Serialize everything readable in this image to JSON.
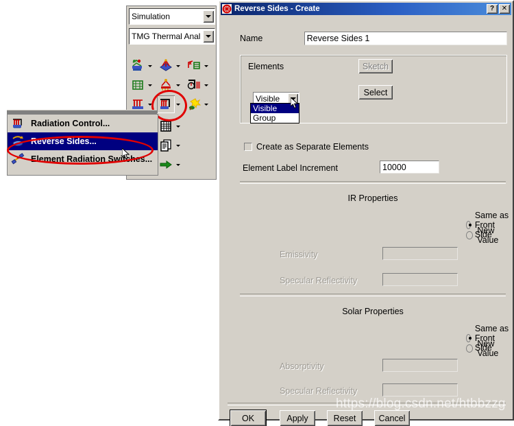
{
  "app": {
    "combos": [
      {
        "name": "application-selector",
        "value": "Simulation"
      },
      {
        "name": "solver-selector",
        "value": "TMG Thermal Anal"
      }
    ],
    "toolbar_top": [
      {
        "icon": "thermal-coupling-icon"
      },
      {
        "icon": "radiative-request-icon"
      },
      {
        "icon": "radiation-group-icon"
      },
      {
        "icon": "mesh-control-icon"
      },
      {
        "icon": "radiation-compute-icon"
      },
      {
        "icon": "view-factor-icon"
      },
      {
        "icon": "radiation-elements-icon"
      },
      {
        "icon": "reverse-sides-icon"
      },
      {
        "icon": "solar-load-icon"
      }
    ],
    "toolbar_bottom": [
      {
        "icon": "orbit-icon"
      },
      {
        "icon": "grid-table-icon"
      },
      {
        "icon": "coupling-links-icon"
      },
      {
        "icon": "report-copy-icon"
      },
      {
        "icon": "export-file-icon"
      },
      {
        "icon": "run-solve-icon"
      }
    ],
    "context_menu": {
      "items": [
        {
          "label": "Radiation Control...",
          "icon": "radiation-control-icon",
          "selected": false
        },
        {
          "label": "Reverse Sides...",
          "icon": "reverse-sides-icon",
          "selected": true
        },
        {
          "label": "Element Radiation Switches...",
          "icon": "element-radiation-switches-icon",
          "selected": false
        }
      ]
    }
  },
  "dialog": {
    "title": "Reverse Sides - Create",
    "icon": "reverse-sides-app-icon",
    "titlebar_buttons": [
      {
        "name": "help-button",
        "label": "?"
      },
      {
        "name": "close-button",
        "label": "✕"
      }
    ],
    "name_label": "Name",
    "name_value": "Reverse Sides 1",
    "elements_group": {
      "label": "Elements",
      "sketch_label": "Sketch",
      "sketch_enabled": false,
      "select_label": "Select",
      "select_enabled": true,
      "source_selected": "Visible",
      "source_options": [
        "Visible",
        "Group"
      ],
      "dropdown_open": true
    },
    "separate_checkbox": {
      "label": "Create as Separate Elements",
      "checked": false
    },
    "label_increment": {
      "label": "Element Label Increment",
      "value": "10000"
    },
    "ir_properties": {
      "title": "IR Properties",
      "options": [
        {
          "label": "Same as Front Side",
          "selected": true
        },
        {
          "label": "New Value",
          "selected": false
        }
      ],
      "fields": [
        {
          "label": "Emissivity",
          "value": "",
          "enabled": false
        },
        {
          "label": "Specular Reflectivity",
          "value": "",
          "enabled": false
        }
      ]
    },
    "solar_properties": {
      "title": "Solar Properties",
      "options": [
        {
          "label": "Same as Front Side",
          "selected": true
        },
        {
          "label": "New Value",
          "selected": false
        }
      ],
      "fields": [
        {
          "label": "Absorptivity",
          "value": "",
          "enabled": false
        },
        {
          "label": "Specular Reflectivity",
          "value": "",
          "enabled": false
        }
      ]
    },
    "buttons": [
      {
        "name": "ok-button",
        "label": "OK",
        "default": true
      },
      {
        "name": "apply-button",
        "label": "Apply",
        "default": false
      },
      {
        "name": "reset-button",
        "label": "Reset",
        "default": false
      },
      {
        "name": "cancel-button",
        "label": "Cancel",
        "default": false
      }
    ]
  },
  "annotations": {
    "highlight_color": "#e00000",
    "watermark": "https://blog.csdn.net/htbbzzg"
  }
}
